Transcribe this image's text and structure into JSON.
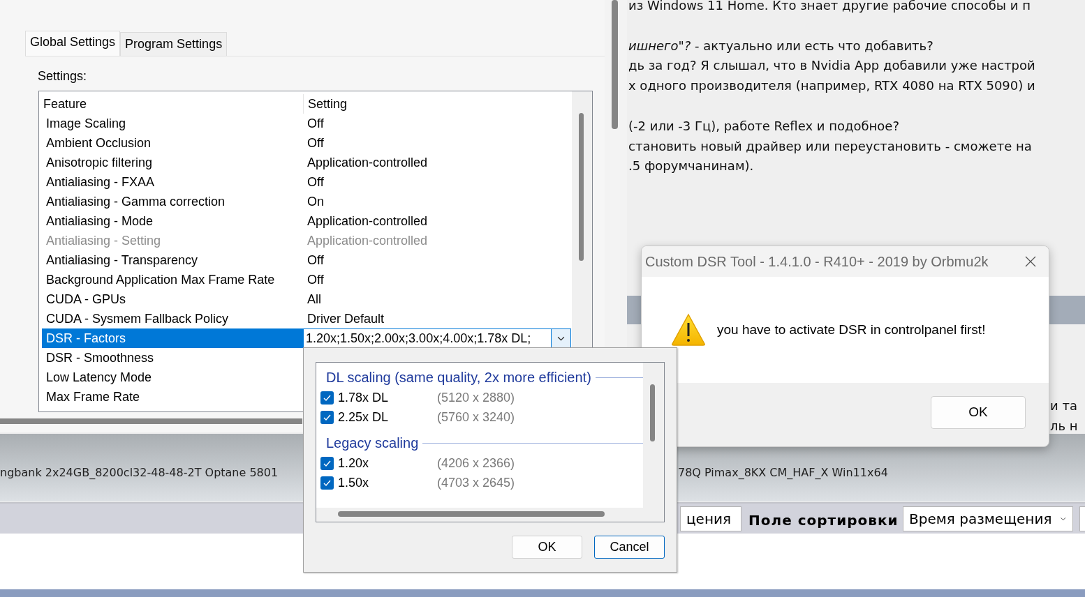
{
  "nvidia_panel": {
    "tabs": [
      {
        "label": "Global Settings",
        "selected": true
      },
      {
        "label": "Program Settings",
        "selected": false
      }
    ],
    "settings_label": "Settings:",
    "table": {
      "columns": [
        "Feature",
        "Setting"
      ],
      "rows": [
        {
          "feature": "Image Scaling",
          "setting": "Off",
          "disabled": false,
          "selected": false
        },
        {
          "feature": "Ambient Occlusion",
          "setting": "Off",
          "disabled": false,
          "selected": false
        },
        {
          "feature": "Anisotropic filtering",
          "setting": "Application-controlled",
          "disabled": false,
          "selected": false
        },
        {
          "feature": "Antialiasing - FXAA",
          "setting": "Off",
          "disabled": false,
          "selected": false
        },
        {
          "feature": "Antialiasing - Gamma correction",
          "setting": "On",
          "disabled": false,
          "selected": false
        },
        {
          "feature": "Antialiasing - Mode",
          "setting": "Application-controlled",
          "disabled": false,
          "selected": false
        },
        {
          "feature": "Antialiasing - Setting",
          "setting": "Application-controlled",
          "disabled": true,
          "selected": false
        },
        {
          "feature": "Antialiasing - Transparency",
          "setting": "Off",
          "disabled": false,
          "selected": false
        },
        {
          "feature": "Background Application Max Frame Rate",
          "setting": "Off",
          "disabled": false,
          "selected": false
        },
        {
          "feature": "CUDA - GPUs",
          "setting": "All",
          "disabled": false,
          "selected": false
        },
        {
          "feature": "CUDA - Sysmem Fallback Policy",
          "setting": "Driver Default",
          "disabled": false,
          "selected": false
        },
        {
          "feature": "DSR - Factors",
          "setting": "1.20x;1.50x;2.00x;3.00x;4.00x;1.78x DL;",
          "disabled": false,
          "selected": true
        },
        {
          "feature": "DSR - Smoothness",
          "disabled": false,
          "selected": false
        },
        {
          "feature": "Low Latency Mode",
          "disabled": false,
          "selected": false
        },
        {
          "feature": "Max Frame Rate",
          "disabled": false,
          "selected": false
        }
      ]
    }
  },
  "forum": {
    "post_paragraphs": [
      [
        "из Windows 11 Home. Кто знает другие рабочие способы и п"
      ],
      [
        "*ишнего\"?* - актуально или есть что добавить?",
        "дь за год? Я слышал, что в Nvidia App добавили уже настрой",
        "х одного производителя (например, RTX 4080 на RTX 5090) и"
      ],
      [
        "(-2 или -3 Гц), работе Reflex и подобное?",
        "становить новый драйвер или переустановить - сможете на",
        ".5 форумчанинам)."
      ]
    ],
    "side_lines": [
      "и та",
      "ль н"
    ],
    "signature_left": "ngbank 2x24GB_8200cl32-48-48-2T Optane 5801",
    "signature_right": "78Q Pimax_8KX CM_HAF_X Win11x64",
    "sort_bar": {
      "order_select": "цения",
      "sort_label": "Поле сортировки",
      "sort_select": "Время размещения"
    }
  },
  "dsr_tool_dialog": {
    "title": "Custom DSR Tool - 1.4.1.0 - R410+ - 2019 by Orbmu2k",
    "message": "you have to activate DSR in controlpanel first!",
    "button": "OK"
  },
  "dsr_factors_popup": {
    "groups": [
      {
        "title": "DL scaling (same quality, 2x more efficient)",
        "items": [
          {
            "label": "1.78x DL",
            "resolution": "(5120 x 2880)",
            "checked": true
          },
          {
            "label": "2.25x DL",
            "resolution": "(5760 x 3240)",
            "checked": true
          }
        ]
      },
      {
        "title": "Legacy scaling",
        "items": [
          {
            "label": "1.20x",
            "resolution": "(4206 x 2366)",
            "checked": true
          },
          {
            "label": "1.50x",
            "resolution": "(4703 x 2645)",
            "checked": true
          }
        ]
      }
    ],
    "buttons": [
      "OK",
      "Cancel"
    ]
  }
}
